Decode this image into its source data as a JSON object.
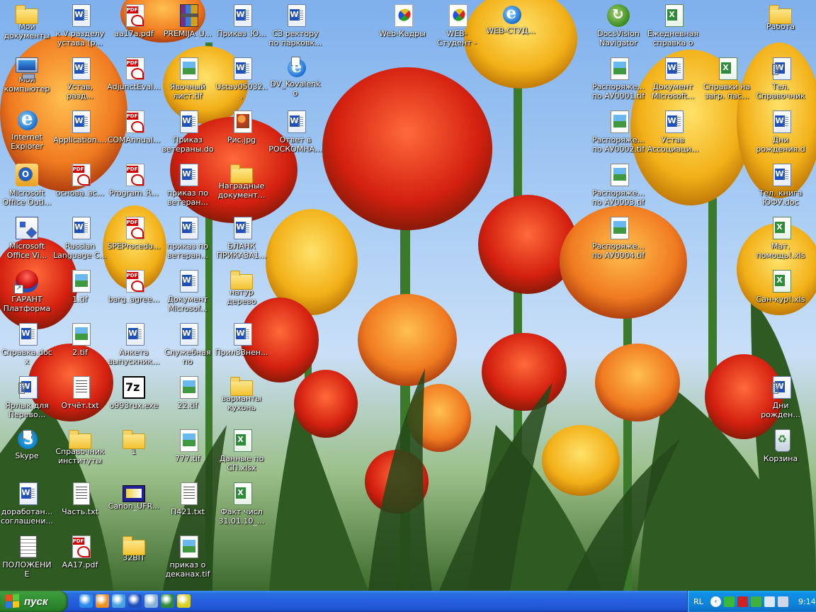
{
  "desktop": {
    "icons": [
      {
        "label": "Мои документы",
        "icon": "my-documents-folder-icon",
        "glyph": "folder"
      },
      {
        "label": "Мой компьютер",
        "icon": "my-computer-icon",
        "glyph": "pc"
      },
      {
        "label": "Internet Explorer",
        "icon": "internet-explorer-icon",
        "glyph": "ie"
      },
      {
        "label": "Microsoft Office Outl...",
        "icon": "outlook-icon",
        "glyph": "outlook",
        "shortcut": true
      },
      {
        "label": "Microsoft Office Vi...",
        "icon": "visio-icon",
        "glyph": "visio",
        "shortcut": true
      },
      {
        "label": "ГАРАНТ Платформа ...",
        "icon": "garant-icon",
        "glyph": "garant",
        "shortcut": true
      },
      {
        "label": "Справка.docx",
        "icon": "word-document-icon",
        "glyph": "doc"
      },
      {
        "label": "Ярлык для Перево...",
        "icon": "word-document-icon",
        "glyph": "doc",
        "shortcut": true
      },
      {
        "label": "Skype",
        "icon": "skype-icon",
        "glyph": "skype",
        "shortcut": true
      },
      {
        "label": "доработан... соглашени...",
        "icon": "word-document-icon",
        "glyph": "doc"
      },
      {
        "label": "ПОЛОЖЕНИЕ",
        "icon": "document-stack-icon",
        "glyph": "stack"
      },
      {
        "label": "к V разделу устава (р...",
        "icon": "word-document-icon",
        "glyph": "doc"
      },
      {
        "label": "Устав, разд...",
        "icon": "word-document-icon",
        "glyph": "doc"
      },
      {
        "label": "Application....",
        "icon": "word-document-icon",
        "glyph": "doc"
      },
      {
        "label": "основа_вс...",
        "icon": "pdf-file-icon",
        "glyph": "pdf"
      },
      {
        "label": "Russian Language C...",
        "icon": "word-document-icon",
        "glyph": "doc"
      },
      {
        "label": "1.tif",
        "icon": "tif-image-icon",
        "glyph": "tif"
      },
      {
        "label": "2.tif",
        "icon": "tif-image-icon",
        "glyph": "tif"
      },
      {
        "label": "Отчёт.txt",
        "icon": "text-file-icon",
        "glyph": "txt"
      },
      {
        "label": "Справочник институты",
        "icon": "folder-icon",
        "glyph": "folder"
      },
      {
        "label": "Часть.txt",
        "icon": "text-file-icon",
        "glyph": "txt"
      },
      {
        "label": "AA17.pdf",
        "icon": "pdf-file-icon",
        "glyph": "pdf"
      },
      {
        "label": "aa17a.pdf",
        "icon": "pdf-file-icon",
        "glyph": "pdf"
      },
      {
        "label": "AdjunctEval...",
        "icon": "pdf-file-icon",
        "glyph": "pdf"
      },
      {
        "label": "COMAnnual...",
        "icon": "pdf-file-icon",
        "glyph": "pdf"
      },
      {
        "label": "Program_R...",
        "icon": "pdf-file-icon",
        "glyph": "pdf"
      },
      {
        "label": "SPEProcedu...",
        "icon": "pdf-file-icon",
        "glyph": "pdf"
      },
      {
        "label": "barg_agree...",
        "icon": "pdf-file-icon",
        "glyph": "pdf"
      },
      {
        "label": "Анкета выпускник...",
        "icon": "word-document-icon",
        "glyph": "doc"
      },
      {
        "label": "o993rux.exe",
        "icon": "7zip-icon",
        "glyph": "7z"
      },
      {
        "label": "1",
        "icon": "folder-icon",
        "glyph": "folder"
      },
      {
        "label": "Canon_UFR...",
        "icon": "canon-driver-icon",
        "glyph": "canon"
      },
      {
        "label": "32BIT",
        "icon": "folder-icon",
        "glyph": "folder"
      },
      {
        "label": "PREMIJA_U...",
        "icon": "rar-archive-icon",
        "glyph": "rar"
      },
      {
        "label": "Явочный лист.tif",
        "icon": "tif-image-icon",
        "glyph": "tif"
      },
      {
        "label": "Приказ ветераны.doc",
        "icon": "word-document-icon",
        "glyph": "doc"
      },
      {
        "label": "приказ по ветеран...",
        "icon": "word-document-icon",
        "glyph": "doc"
      },
      {
        "label": "приказ по ветеран...",
        "icon": "word-document-icon",
        "glyph": "doc"
      },
      {
        "label": "Документ Microsof...",
        "icon": "word-document-icon",
        "glyph": "doc"
      },
      {
        "label": "Служебная по ветеранам....",
        "icon": "word-document-icon",
        "glyph": "doc"
      },
      {
        "label": "22.tif",
        "icon": "tif-image-icon",
        "glyph": "tif"
      },
      {
        "label": "777.tif",
        "icon": "tif-image-icon",
        "glyph": "tif"
      },
      {
        "label": "П421.txt",
        "icon": "text-file-icon",
        "glyph": "txt"
      },
      {
        "label": "приказ о деканах.tif",
        "icon": "tif-image-icon",
        "glyph": "tif"
      },
      {
        "label": "Приказ_Ю...",
        "icon": "word-document-icon",
        "glyph": "doc"
      },
      {
        "label": "Ustav05032...",
        "icon": "word-document-icon",
        "glyph": "doc"
      },
      {
        "label": "Рис.jpg",
        "icon": "jpg-image-icon",
        "glyph": "jpg"
      },
      {
        "label": "Наградные документ...",
        "icon": "folder-icon",
        "glyph": "folder"
      },
      {
        "label": "БЛАНК ПРИКАЗА1...",
        "icon": "word-document-icon",
        "glyph": "doc"
      },
      {
        "label": "натур дерево",
        "icon": "folder-icon",
        "glyph": "folder"
      },
      {
        "label": "Прил33нен...",
        "icon": "word-document-icon",
        "glyph": "doc"
      },
      {
        "label": "варианты кухонь",
        "icon": "folder-icon",
        "glyph": "folder"
      },
      {
        "label": "Данные по СП.xlsx",
        "icon": "excel-file-icon",
        "glyph": "xls"
      },
      {
        "label": "Факт числ 31.01.10_...",
        "icon": "excel-file-icon",
        "glyph": "xls"
      },
      {
        "label": "СЗ ректору по парковк...",
        "icon": "word-document-icon",
        "glyph": "doc"
      },
      {
        "label": "DV_Kovalenko",
        "icon": "internet-shortcut-icon",
        "glyph": "ieshort",
        "shortcut": true
      },
      {
        "label": "Ответ в РОСКОМНА...",
        "icon": "word-document-icon",
        "glyph": "doc"
      },
      {
        "label": "Web-Кадры",
        "icon": "web-app-icon",
        "glyph": "web"
      },
      {
        "label": "WEB-Студент -",
        "icon": "web-app-icon",
        "glyph": "web"
      },
      {
        "label": "WEB-СТУД...",
        "icon": "internet-shortcut-icon",
        "glyph": "ieshort"
      },
      {
        "label": "DocsVision Navigator",
        "icon": "docsvision-icon",
        "glyph": "docsvision"
      },
      {
        "label": "Распоряже... по АУ0001.tif",
        "icon": "tif-image-icon",
        "glyph": "tif"
      },
      {
        "label": "Распоряже... по АУ0002.tif",
        "icon": "tif-image-icon",
        "glyph": "tif"
      },
      {
        "label": "Распоряже... по АУ0003.tif",
        "icon": "tif-image-icon",
        "glyph": "tif"
      },
      {
        "label": "Распоряже... по АУ0004.tif",
        "icon": "tif-image-icon",
        "glyph": "tif"
      },
      {
        "label": "Ежедневная справка о м...",
        "icon": "excel-file-icon",
        "glyph": "xls"
      },
      {
        "label": "Документ Microsoft...",
        "icon": "word-document-icon",
        "glyph": "doc"
      },
      {
        "label": "Устав Ассоциаци...",
        "icon": "word-document-icon",
        "glyph": "doc"
      },
      {
        "label": "Справки на загр. пас...",
        "icon": "excel-file-icon",
        "glyph": "xls"
      },
      {
        "label": "Работа",
        "icon": "folder-icon",
        "glyph": "folder"
      },
      {
        "label": "Тел. Справочник",
        "icon": "word-document-icon",
        "glyph": "doc",
        "shortcut": true
      },
      {
        "label": "Дни рождения.doc",
        "icon": "word-document-icon",
        "glyph": "doc"
      },
      {
        "label": "Тел. книга ЮФУ.doc",
        "icon": "word-document-icon",
        "glyph": "doc"
      },
      {
        "label": "Мат. помощь!.xls",
        "icon": "excel-file-icon",
        "glyph": "xls"
      },
      {
        "label": "Сан-кур!.xls",
        "icon": "excel-file-icon",
        "glyph": "xls"
      },
      {
        "label": "Дни рожден...",
        "icon": "word-document-icon",
        "glyph": "doc",
        "shortcut": true
      },
      {
        "label": "Корзина",
        "icon": "recycle-bin-icon",
        "glyph": "recycle"
      }
    ]
  },
  "taskbar": {
    "start_label": "пуск",
    "quick_launch": [
      {
        "icon": "internet-explorer-icon",
        "color": "#2a8ae8"
      },
      {
        "icon": "media-player-icon",
        "color": "#f09020"
      },
      {
        "icon": "outlook-express-icon",
        "color": "#4aa0e0"
      },
      {
        "icon": "word-icon",
        "color": "#1f4fb8"
      },
      {
        "icon": "network-icon",
        "color": "#8ab0d8"
      },
      {
        "icon": "excel-icon",
        "color": "#2e8b3a"
      },
      {
        "icon": "app-icon",
        "color": "#d8d020"
      }
    ],
    "tray": {
      "language": "RL",
      "icons": [
        {
          "icon": "antivirus-icon",
          "color": "#3ab83a"
        },
        {
          "icon": "kaspersky-icon",
          "color": "#d02020"
        },
        {
          "icon": "network-status-icon",
          "color": "#40b040"
        },
        {
          "icon": "printer-icon",
          "color": "#dfe7f2"
        },
        {
          "icon": "volume-icon",
          "color": "#cfd8e8"
        }
      ],
      "clock": "9:14"
    }
  }
}
